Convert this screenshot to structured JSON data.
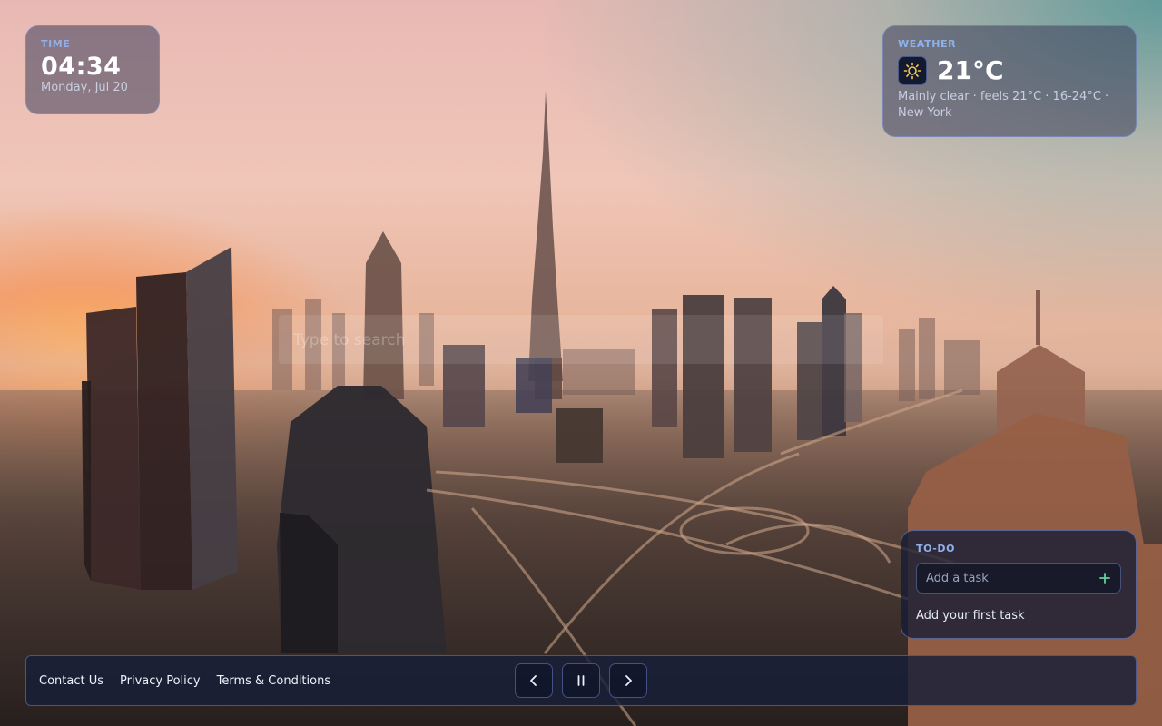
{
  "time_widget": {
    "label": "TIME",
    "time": "04:34",
    "date": "Monday, Jul 20"
  },
  "weather_widget": {
    "label": "WEATHER",
    "icon": "sun-icon",
    "temperature": "21°C",
    "description": "Mainly clear · feels 21°C · 16-24°C · New York"
  },
  "search": {
    "placeholder": "Type to search"
  },
  "todo_widget": {
    "label": "TO-DO",
    "input_placeholder": "Add a task",
    "add_icon": "plus-icon",
    "empty_message": "Add your first task"
  },
  "footer": {
    "links": [
      "Contact Us",
      "Privacy Policy",
      "Terms & Conditions"
    ],
    "controls": {
      "previous_icon": "chevron-left-icon",
      "pause_icon": "pause-icon",
      "next_icon": "chevron-right-icon"
    }
  },
  "colors": {
    "accent_label": "#8fb0ea",
    "add_icon": "#5fd39a",
    "sun_icon": "#f4c860"
  }
}
